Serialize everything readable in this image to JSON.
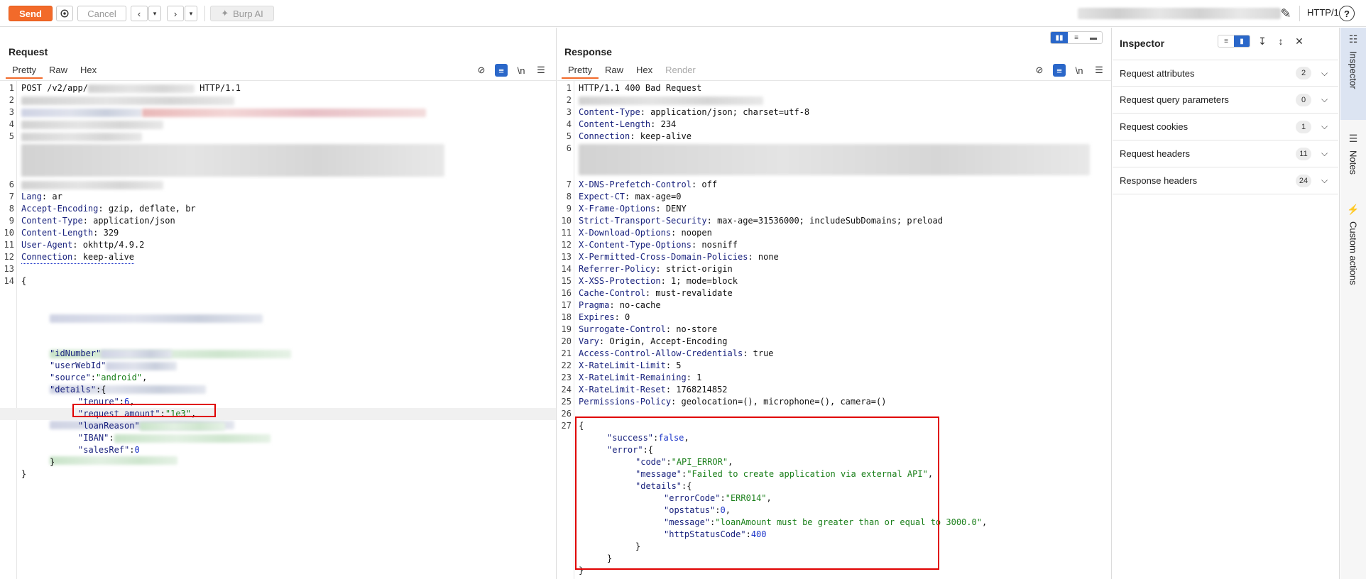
{
  "toolbar": {
    "send": "Send",
    "cancel": "Cancel",
    "burp_ai": "Burp AI",
    "protocol": "HTTP/1",
    "help": "?"
  },
  "request": {
    "title": "Request",
    "tabs": [
      "Pretty",
      "Raw",
      "Hex"
    ],
    "newline_toggle": "\\n",
    "lines": {
      "l1_method": "POST /v2/app/",
      "l1_version": "HTTP/1.1",
      "l7": [
        "Lang",
        ": ar"
      ],
      "l8": [
        "Accept-Encoding",
        ": gzip, deflate, br"
      ],
      "l9": [
        "Content-Type",
        ": application/json"
      ],
      "l10": [
        "Content-Length",
        ": 329"
      ],
      "l11": [
        "User-Agent",
        ": okhttp/4.9.2"
      ],
      "l12": [
        "Connection",
        ": keep-alive"
      ],
      "open_brace": "{",
      "close_brace": "}",
      "idNumber_key": "\"idNumber\"",
      "userWebId_key": "\"userWebId\"",
      "source_key": "\"source\"",
      "source_val": "\"android\"",
      "details_key": "\"details\"",
      "tenure_key": "\"tenure\"",
      "tenure_val": "6",
      "request_amount_key": "\"request amount\"",
      "request_amount_val": "\"1e3\"",
      "loanReason_key": "\"loanReason\"",
      "IBAN_key": "\"IBAN\"",
      "salesRef_key": "\"salesRef\"",
      "salesRef_val": "0"
    }
  },
  "response": {
    "title": "Response",
    "tabs": [
      "Pretty",
      "Raw",
      "Hex",
      "Render"
    ],
    "newline_toggle": "\\n",
    "status_line": "HTTP/1.1 400 Bad Request",
    "headers": [
      {
        "n": "3",
        "k": "Content-Type",
        "v": ": application/json; charset=utf-8"
      },
      {
        "n": "4",
        "k": "Content-Length",
        "v": ": 234"
      },
      {
        "n": "5",
        "k": "Connection",
        "v": ": keep-alive"
      },
      {
        "n": "7",
        "k": "X-DNS-Prefetch-Control",
        "v": ": off"
      },
      {
        "n": "8",
        "k": "Expect-CT",
        "v": ": max-age=0"
      },
      {
        "n": "9",
        "k": "X-Frame-Options",
        "v": ": DENY"
      },
      {
        "n": "10",
        "k": "Strict-Transport-Security",
        "v": ": max-age=31536000; includeSubDomains; preload"
      },
      {
        "n": "11",
        "k": "X-Download-Options",
        "v": ": noopen"
      },
      {
        "n": "12",
        "k": "X-Content-Type-Options",
        "v": ": nosniff"
      },
      {
        "n": "13",
        "k": "X-Permitted-Cross-Domain-Policies",
        "v": ": none"
      },
      {
        "n": "14",
        "k": "Referrer-Policy",
        "v": ": strict-origin"
      },
      {
        "n": "15",
        "k": "X-XSS-Protection",
        "v": ": 1; mode=block"
      },
      {
        "n": "16",
        "k": "Cache-Control",
        "v": ": must-revalidate"
      },
      {
        "n": "17",
        "k": "Pragma",
        "v": ": no-cache"
      },
      {
        "n": "18",
        "k": "Expires",
        "v": ": 0"
      },
      {
        "n": "19",
        "k": "Surrogate-Control",
        "v": ": no-store"
      },
      {
        "n": "20",
        "k": "Vary",
        "v": ": Origin, Accept-Encoding"
      },
      {
        "n": "21",
        "k": "Access-Control-Allow-Credentials",
        "v": ": true"
      },
      {
        "n": "22",
        "k": "X-RateLimit-Limit",
        "v": ": 5"
      },
      {
        "n": "23",
        "k": "X-RateLimit-Remaining",
        "v": ": 1"
      },
      {
        "n": "24",
        "k": "X-RateLimit-Reset",
        "v": ": 1768214852"
      },
      {
        "n": "25",
        "k": "Permissions-Policy",
        "v": ": geolocation=(), microphone=(), camera=()"
      }
    ],
    "body": {
      "open": "{",
      "success_key": "\"success\"",
      "success_val": "false",
      "error_key": "\"error\"",
      "code_key": "\"code\"",
      "code_val": "\"API_ERROR\"",
      "message_key": "\"message\"",
      "message_val": "\"Failed to create application via external API\"",
      "details_key": "\"details\"",
      "errorCode_key": "\"errorCode\"",
      "errorCode_val": "\"ERR014\"",
      "opstatus_key": "\"opstatus\"",
      "opstatus_val": "0",
      "details_message_key": "\"message\"",
      "details_message_val": "\"loanAmount must be greater than or equal to 3000.0\"",
      "httpStatusCode_key": "\"httpStatusCode\"",
      "httpStatusCode_val": "400",
      "close_inner": "}",
      "close_error": "}",
      "close": "}"
    }
  },
  "inspector": {
    "title": "Inspector",
    "rows": [
      {
        "label": "Request attributes",
        "count": "2"
      },
      {
        "label": "Request query parameters",
        "count": "0"
      },
      {
        "label": "Request cookies",
        "count": "1"
      },
      {
        "label": "Request headers",
        "count": "11"
      },
      {
        "label": "Response headers",
        "count": "24"
      }
    ]
  },
  "rail": {
    "inspector": "Inspector",
    "notes": "Notes",
    "custom_actions": "Custom actions"
  },
  "colors": {
    "send_button": "#f26a2a",
    "highlight_box": "#e00000",
    "string_green": "#1a7f1a",
    "number_blue": "#1a33c8",
    "accent_blue": "#2a67c9"
  }
}
